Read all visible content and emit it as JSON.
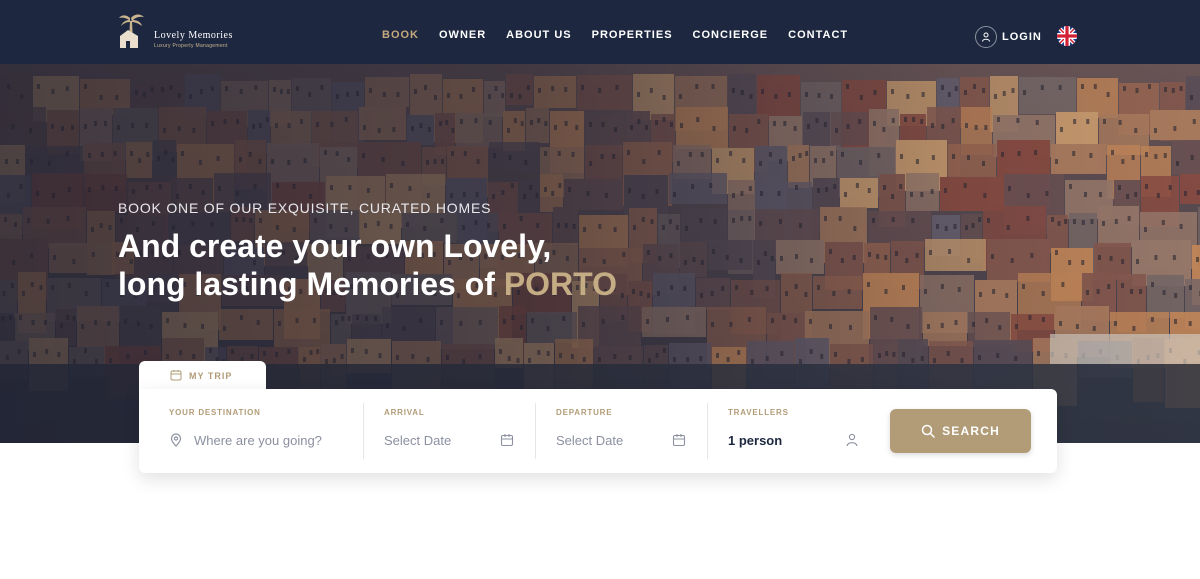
{
  "brand": {
    "name": "Lovely Memories",
    "tagline": "Luxury Property Management",
    "logo_icon": "palm-house-icon",
    "accent_color": "#c4a77f"
  },
  "nav": {
    "items": [
      {
        "label": "BOOK",
        "active": true
      },
      {
        "label": "OWNER",
        "active": false
      },
      {
        "label": "ABOUT US",
        "active": false
      },
      {
        "label": "PROPERTIES",
        "active": false
      },
      {
        "label": "CONCIERGE",
        "active": false
      },
      {
        "label": "CONTACT",
        "active": false
      }
    ],
    "login_label": "LOGIN",
    "login_icon": "user-icon",
    "language_icon": "uk-flag-icon"
  },
  "hero": {
    "kicker": "BOOK ONE OF OUR EXQUISITE, CURATED HOMES",
    "title_line1": "And create your own Lovely,",
    "title_line2": "long lasting Memories of ",
    "title_accent": "PORTO"
  },
  "search": {
    "tab_label": "MY TRIP",
    "tab_icon": "calendar-icon",
    "destination": {
      "label": "YOUR DESTINATION",
      "placeholder": "Where are you going?",
      "icon": "location-pin-icon"
    },
    "arrival": {
      "label": "ARRIVAL",
      "placeholder": "Select Date",
      "icon": "calendar-icon"
    },
    "departure": {
      "label": "DEPARTURE",
      "placeholder": "Select Date",
      "icon": "calendar-icon"
    },
    "travellers": {
      "label": "TRAVELLERS",
      "value": "1 person",
      "icon": "user-icon"
    },
    "button_label": "SEARCH",
    "button_icon": "search-icon",
    "button_color": "#b29c78"
  },
  "colors": {
    "header_bg": "#1d2840",
    "gold": "#b29c78"
  }
}
